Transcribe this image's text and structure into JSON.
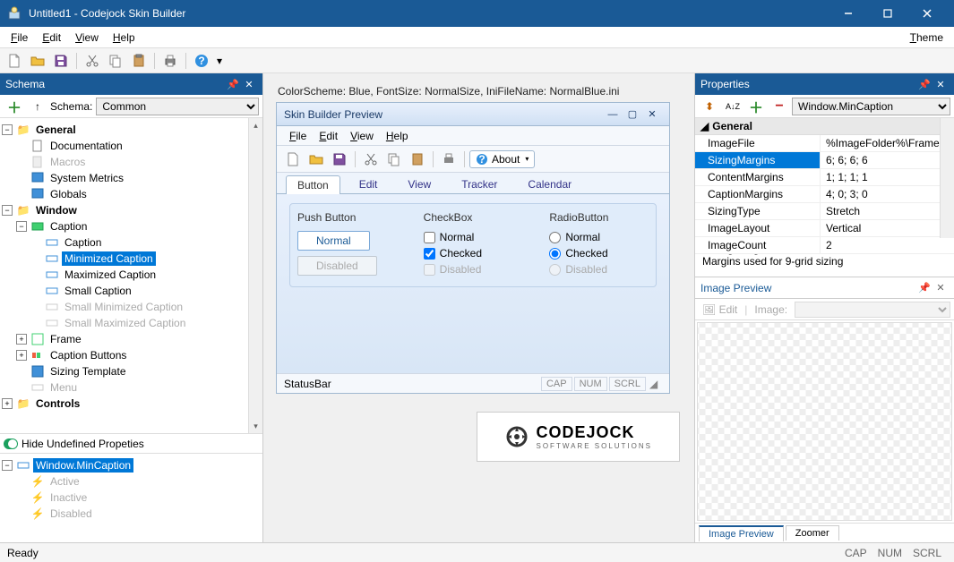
{
  "titlebar": {
    "title": "Untitled1 - Codejock Skin Builder"
  },
  "menubar": {
    "file": "File",
    "edit": "Edit",
    "view": "View",
    "help": "Help",
    "theme": "Theme"
  },
  "schemaPanel": {
    "title": "Schema",
    "schemaLabel": "Schema:",
    "schemaValue": "Common",
    "tree": {
      "general": "General",
      "documentation": "Documentation",
      "macros": "Macros",
      "systemMetrics": "System Metrics",
      "globals": "Globals",
      "window": "Window",
      "caption": "Caption",
      "captionChild": "Caption",
      "minimizedCaption": "Minimized Caption",
      "maximizedCaption": "Maximized Caption",
      "smallCaption": "Small Caption",
      "smallMinCaption": "Small Minimized Caption",
      "smallMaxCaption": "Small Maximized Caption",
      "frame": "Frame",
      "captionButtons": "Caption Buttons",
      "sizingTemplate": "Sizing Template",
      "menu": "Menu",
      "controls": "Controls"
    },
    "hideUndefined": "Hide Undefined Propeties",
    "states": {
      "root": "Window.MinCaption",
      "active": "Active",
      "inactive": "Inactive",
      "disabled": "Disabled"
    }
  },
  "center": {
    "colorScheme": "ColorScheme: Blue, FontSize: NormalSize, IniFileName: NormalBlue.ini",
    "previewTitle": "Skin Builder Preview",
    "previewMenus": {
      "file": "File",
      "edit": "Edit",
      "view": "View",
      "help": "Help"
    },
    "about": "About",
    "tabs": {
      "button": "Button",
      "edit": "Edit",
      "view": "View",
      "tracker": "Tracker",
      "calendar": "Calendar"
    },
    "pushButton": "Push Button",
    "normalBtn": "Normal",
    "disabledBtn": "Disabled",
    "checkbox": "CheckBox",
    "cbNormal": "Normal",
    "cbChecked": "Checked",
    "cbDisabled": "Disabled",
    "radiobutton": "RadioButton",
    "rbNormal": "Normal",
    "rbChecked": "Checked",
    "rbDisabled": "Disabled",
    "statusBar": "StatusBar",
    "cap": "CAP",
    "num": "NUM",
    "scrl": "SCRL",
    "logoMain": "CODEJOCK",
    "logoSub": "SOFTWARE SOLUTIONS"
  },
  "properties": {
    "title": "Properties",
    "combo": "Window.MinCaption",
    "group": "General",
    "rows": {
      "imageFile": {
        "k": "ImageFile",
        "v": "%ImageFolder%\\Frame"
      },
      "sizingMargins": {
        "k": "SizingMargins",
        "v": "6; 6; 6; 6"
      },
      "contentMargins": {
        "k": "ContentMargins",
        "v": "1; 1; 1; 1"
      },
      "captionMargins": {
        "k": "CaptionMargins",
        "v": "4; 0; 3; 0"
      },
      "sizingType": {
        "k": "SizingType",
        "v": "Stretch"
      },
      "imageLayout": {
        "k": "ImageLayout",
        "v": "Vertical"
      },
      "imageCount": {
        "k": "ImageCount",
        "v": "2"
      }
    },
    "descTitle": "SizingMargins",
    "descText": "Margins used for 9-grid sizing"
  },
  "imagePreview": {
    "title": "Image Preview",
    "edit": "Edit",
    "imageLabel": "Image:",
    "tabs": {
      "preview": "Image Preview",
      "zoomer": "Zoomer"
    }
  },
  "statusbar": {
    "ready": "Ready",
    "cap": "CAP",
    "num": "NUM",
    "scrl": "SCRL"
  }
}
